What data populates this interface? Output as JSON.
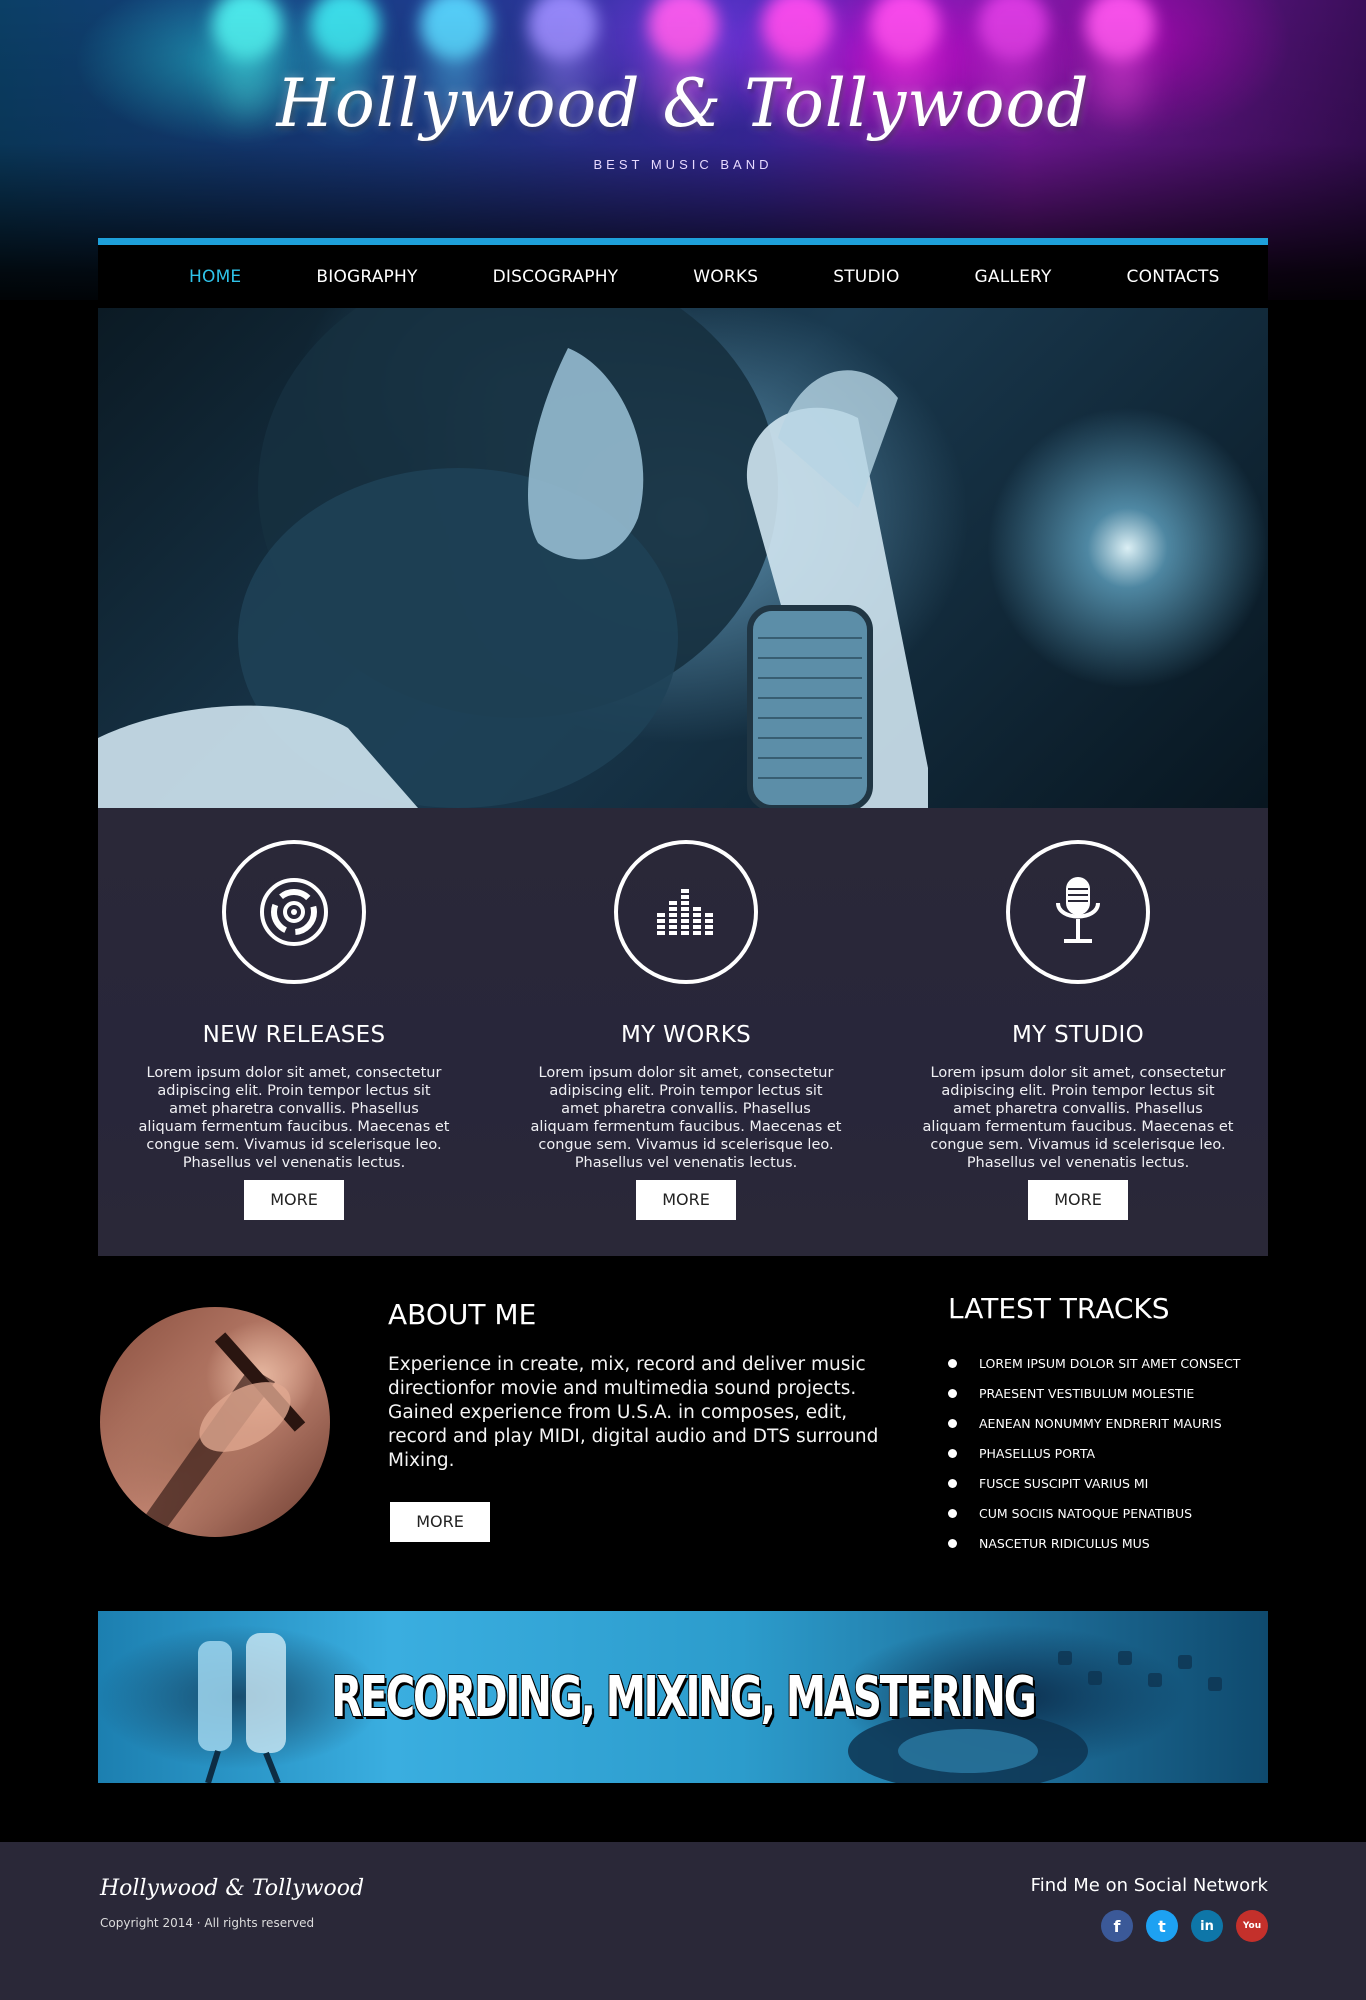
{
  "header": {
    "logo": "Hollywood & Tollywood",
    "tagline": "BEST MUSIC BAND"
  },
  "colors": {
    "accent": "#1ea0da",
    "nav_active": "#2fc3ea",
    "panel": "#2a2838"
  },
  "nav": {
    "items": [
      {
        "label": "HOME",
        "active": true
      },
      {
        "label": "BIOGRAPHY"
      },
      {
        "label": "DISCOGRAPHY"
      },
      {
        "label": "WORKS"
      },
      {
        "label": "STUDIO"
      },
      {
        "label": "GALLERY"
      },
      {
        "label": "CONTACTS"
      }
    ]
  },
  "features": [
    {
      "icon": "vinyl-disc-icon",
      "title": "NEW RELEASES",
      "text": "Lorem ipsum dolor sit amet, consectetur adipiscing elit. Proin tempor lectus sit amet pharetra convallis. Phasellus aliquam fermentum faucibus. Maecenas et congue sem. Vivamus id scelerisque leo. Phasellus vel venenatis lectus.",
      "button": "MORE"
    },
    {
      "icon": "equalizer-icon",
      "title": "MY WORKS",
      "text": "Lorem ipsum dolor sit amet, consectetur adipiscing elit. Proin tempor lectus sit amet pharetra convallis. Phasellus aliquam fermentum faucibus. Maecenas et congue sem. Vivamus id scelerisque leo. Phasellus vel venenatis lectus.",
      "button": "MORE"
    },
    {
      "icon": "microphone-icon",
      "title": "MY STUDIO",
      "text": "Lorem ipsum dolor sit amet, consectetur adipiscing elit. Proin tempor lectus sit amet pharetra convallis. Phasellus aliquam fermentum faucibus. Maecenas et congue sem. Vivamus id scelerisque leo. Phasellus vel venenatis lectus.",
      "button": "MORE"
    }
  ],
  "about": {
    "title": "ABOUT ME",
    "text": "Experience in create, mix, record and deliver music directionfor movie and multimedia sound projects. Gained experience from U.S.A. in composes, edit, record and play MIDI, digital audio and DTS surround Mixing.",
    "button": "MORE"
  },
  "tracks": {
    "title": "LATEST TRACKS",
    "items": [
      "LOREM IPSUM DOLOR SIT AMET CONSECT",
      "PRAESENT VESTIBULUM MOLESTIE",
      "AENEAN NONUMMY ENDRERIT MAURIS",
      "PHASELLUS PORTA",
      "FUSCE SUSCIPIT VARIUS MI",
      "CUM SOCIIS NATOQUE PENATIBUS",
      "NASCETUR RIDICULUS MUS"
    ]
  },
  "recording_banner": {
    "text": "RECORDING, MIXING, MASTERING"
  },
  "footer": {
    "logo": "Hollywood & Tollywood",
    "copyright": "Copyright 2014 · All rights reserved",
    "social_title": "Find Me on Social Network",
    "social": [
      {
        "icon": "facebook-icon",
        "glyph": "f",
        "color": "#3b5998"
      },
      {
        "icon": "twitter-icon",
        "glyph": "t",
        "color": "#1da1f2"
      },
      {
        "icon": "linkedin-icon",
        "glyph": "in",
        "color": "#0e76a8"
      },
      {
        "icon": "youtube-icon",
        "glyph": "You",
        "color": "#c4302b"
      }
    ]
  }
}
